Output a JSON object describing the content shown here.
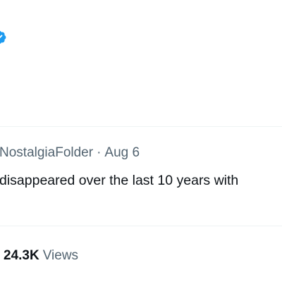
{
  "tweet": {
    "handle": "NostalgiaFolder",
    "separator": "·",
    "date": "Aug 6",
    "text": "disappeared over the last 10 years with",
    "views_count": "24.3K",
    "views_label": "Views"
  },
  "colors": {
    "verified_badge": "#1d9bf0",
    "primary_text": "#0f1419",
    "secondary_text": "#536471",
    "divider": "#eff3f4"
  },
  "icons": {
    "badge": "verified-badge-icon"
  }
}
